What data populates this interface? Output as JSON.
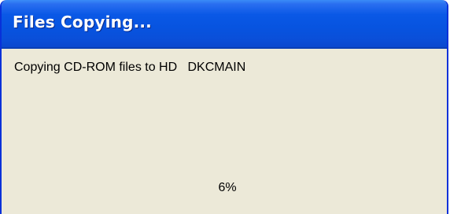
{
  "window": {
    "title": "Files Copying...",
    "message": "Copying CD-ROM files to HD   DKCMAIN",
    "progress_text": "6%",
    "progress": 0.06
  },
  "colors": {
    "title_bar": "#0a58e6",
    "window_border": "#0831d9",
    "client_background": "#ece9d8",
    "title_text": "#ffffff"
  }
}
